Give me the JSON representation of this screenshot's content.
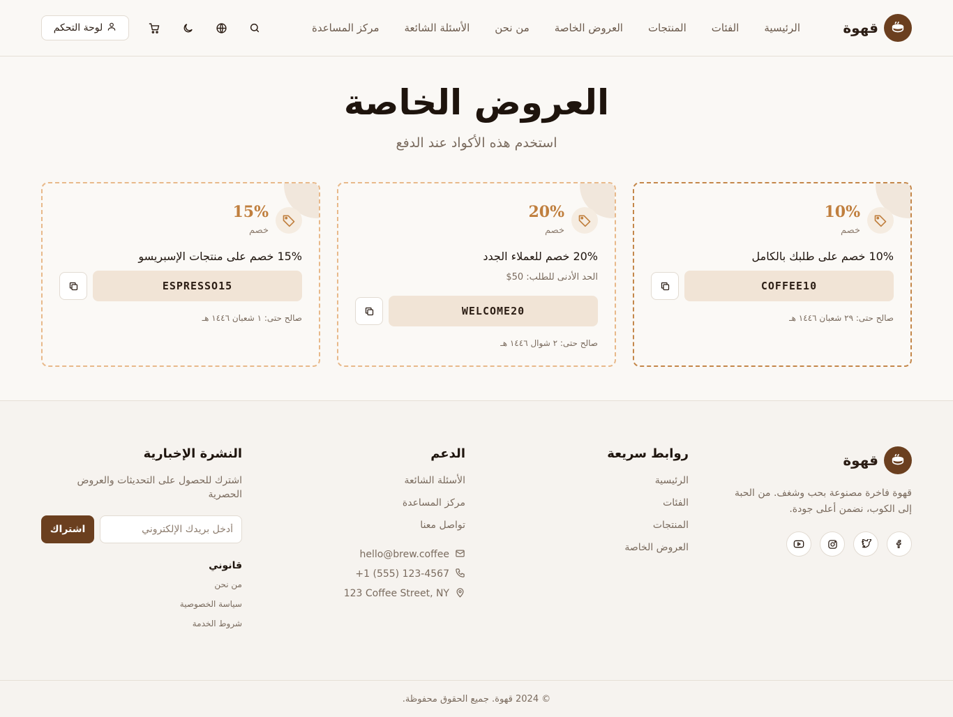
{
  "header": {
    "brand": "قهوة",
    "nav": [
      "الرئيسية",
      "الفئات",
      "المنتجات",
      "العروض الخاصة",
      "من نحن",
      "الأسئلة الشائعة",
      "مركز المساعدة"
    ],
    "dashboard_label": "لوحة التحكم",
    "icons": [
      "search-icon",
      "globe-icon",
      "moon-icon",
      "cart-icon",
      "user-icon"
    ]
  },
  "hero": {
    "title": "العروض الخاصة",
    "subtitle": "استخدم هذه الأكواد عند الدفع"
  },
  "offers": [
    {
      "percent": "10%",
      "off_label": "خصم",
      "description": "10% خصم على طلبك بالكامل",
      "code": "COFFEE10",
      "valid": "صالح حتى: ٢٩ شعبان ١٤٤٦ هـ"
    },
    {
      "percent": "20%",
      "off_label": "خصم",
      "description": "20% خصم للعملاء الجدد",
      "min_order": "الحد الأدنى للطلب: 50$",
      "code": "WELCOME20",
      "valid": "صالح حتى: ٢ شوال ١٤٤٦ هـ"
    },
    {
      "percent": "15%",
      "off_label": "خصم",
      "description": "15% خصم على منتجات الإسبريسو",
      "code": "ESPRESSO15",
      "valid": "صالح حتى: ١ شعبان ١٤٤٦ هـ"
    }
  ],
  "footer": {
    "brand": "قهوة",
    "about": "قهوة فاخرة مصنوعة بحب وشغف. من الحبة إلى الكوب، نضمن أعلى جودة.",
    "socials": [
      "facebook-icon",
      "twitter-icon",
      "instagram-icon",
      "youtube-icon"
    ],
    "quick_links": {
      "title": "روابط سريعة",
      "items": [
        "الرئيسية",
        "الفئات",
        "المنتجات",
        "العروض الخاصة"
      ]
    },
    "support": {
      "title": "الدعم",
      "items": [
        "الأسئلة الشائعة",
        "مركز المساعدة",
        "تواصل معنا"
      ],
      "email": "hello@brew.coffee",
      "phone": "+1 (555) 123-4567",
      "address": "123 Coffee Street, NY"
    },
    "newsletter": {
      "title": "النشرة الإخبارية",
      "description": "اشترك للحصول على التحديثات والعروض الحصرية",
      "placeholder": "أدخل بريدك الإلكتروني",
      "button": "اشتراك"
    },
    "legal": {
      "title": "قانوني",
      "items": [
        "من نحن",
        "سياسة الخصوصية",
        "شروط الخدمة"
      ]
    },
    "copyright": "© 2024 قهوة. جميع الحقوق محفوظة."
  },
  "colors": {
    "brand": "#6b3f1f",
    "accent": "#c07f3e",
    "code_bg": "#f1e4d6",
    "background": "#faf8f5"
  }
}
